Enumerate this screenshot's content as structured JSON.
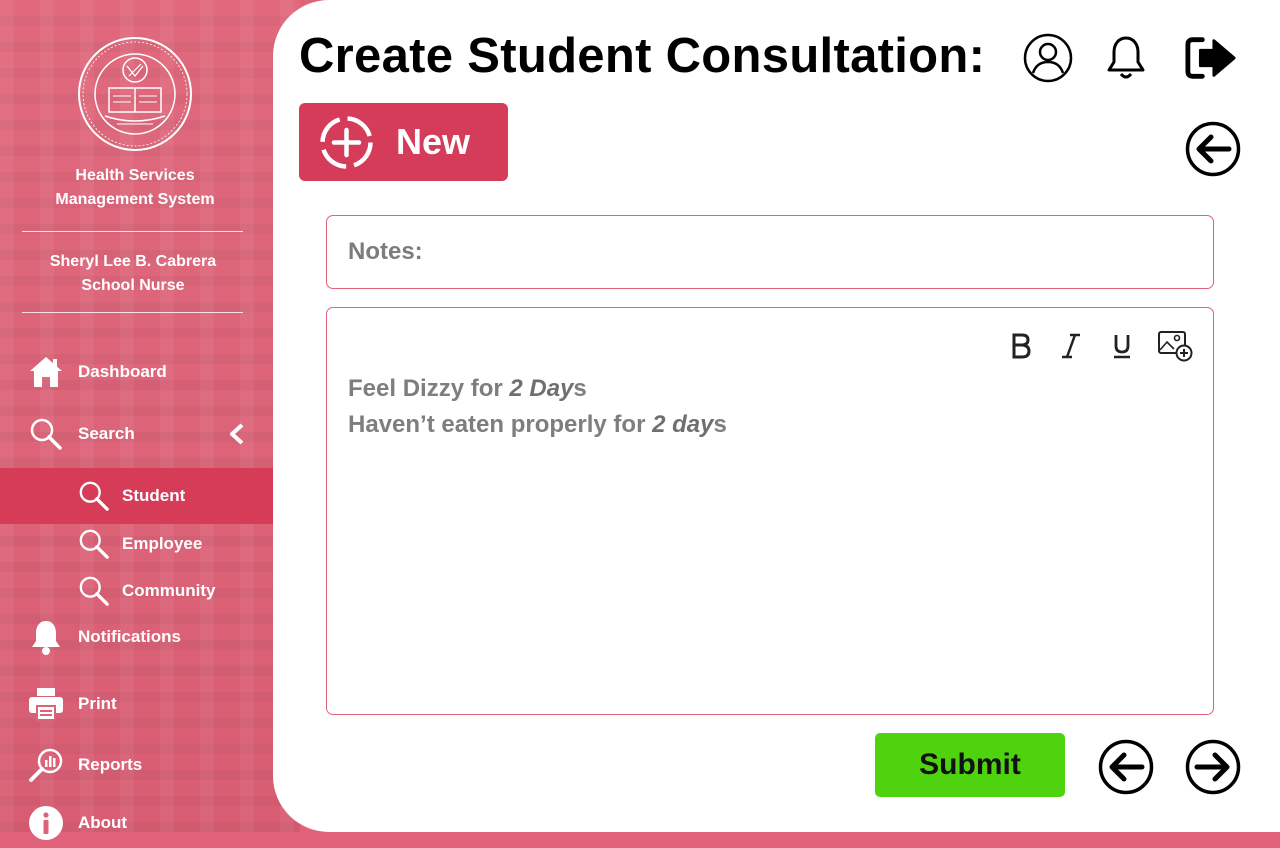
{
  "app": {
    "system_name_line1": "Health Services",
    "system_name_line2": "Management System",
    "user_name": "Sheryl Lee B. Cabrera",
    "user_role": "School Nurse"
  },
  "sidebar": {
    "items": [
      {
        "label": "Dashboard",
        "icon": "home-icon"
      },
      {
        "label": "Search",
        "icon": "search-icon"
      },
      {
        "label": "Notifications",
        "icon": "bell-icon"
      },
      {
        "label": "Print",
        "icon": "printer-icon"
      },
      {
        "label": "Reports",
        "icon": "reports-icon"
      },
      {
        "label": "About",
        "icon": "info-icon"
      }
    ],
    "search_sub": [
      {
        "label": "Student",
        "active": true
      },
      {
        "label": "Employee"
      },
      {
        "label": "Community"
      }
    ]
  },
  "header": {
    "title": "Create Student Consultation:",
    "icons": [
      "user-profile-icon",
      "bell-icon",
      "logout-icon"
    ]
  },
  "actions": {
    "new_label": "New",
    "submit_label": "Submit"
  },
  "notes": {
    "label": "Notes:"
  },
  "editor": {
    "toolbar": [
      "bold",
      "italic",
      "underline",
      "insert-image"
    ],
    "line1_prefix": "Feel Dizzy for ",
    "line1_emph": "2 Day",
    "line1_suffix": "s",
    "line2_prefix": "Haven’t eaten properly for ",
    "line2_emph": "2 day",
    "line2_suffix": "s"
  },
  "colors": {
    "sidebar_bg": "#e0627a",
    "active_item": "#d63b58",
    "new_button": "#d43c59",
    "submit_button": "#4fd30f",
    "border": "#e0627a"
  }
}
